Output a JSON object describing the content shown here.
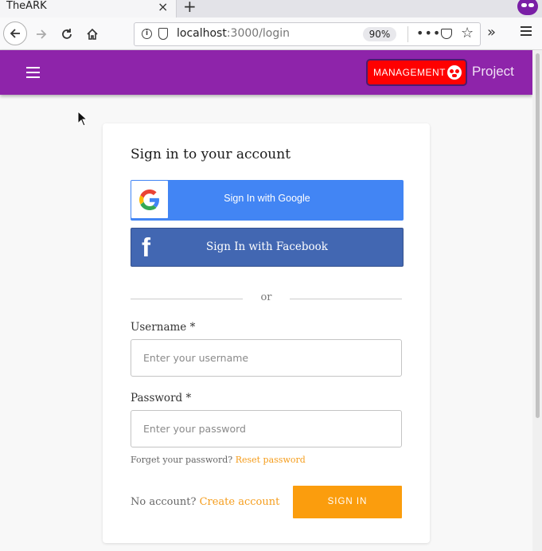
{
  "browser": {
    "tab_title": "TheARK",
    "tab_close": "×",
    "new_tab": "+",
    "url_host": "localhost",
    "url_path": ":3000/login",
    "zoom": "90%",
    "page_actions": "•••",
    "overflow": "»"
  },
  "header": {
    "management_label": "MANAGEMENT",
    "project_label": "Project",
    "brand_color": "#8e24aa",
    "management_color": "#ff0000"
  },
  "login": {
    "title": "Sign in to your account",
    "google_label": "Sign In with Google",
    "facebook_label": "Sign In with Facebook",
    "or_text": "or",
    "username_label": "Username *",
    "username_placeholder": "Enter your username",
    "password_label": "Password *",
    "password_placeholder": "Enter your password",
    "forgot_text": "Forget your password?",
    "reset_link": "Reset password",
    "no_account_text": "No account?",
    "create_account_link": "Create account",
    "signin_label": "SIGN IN",
    "accent_color": "#fb9d0d",
    "google_color": "#4285f4",
    "facebook_color": "#4267b2"
  }
}
